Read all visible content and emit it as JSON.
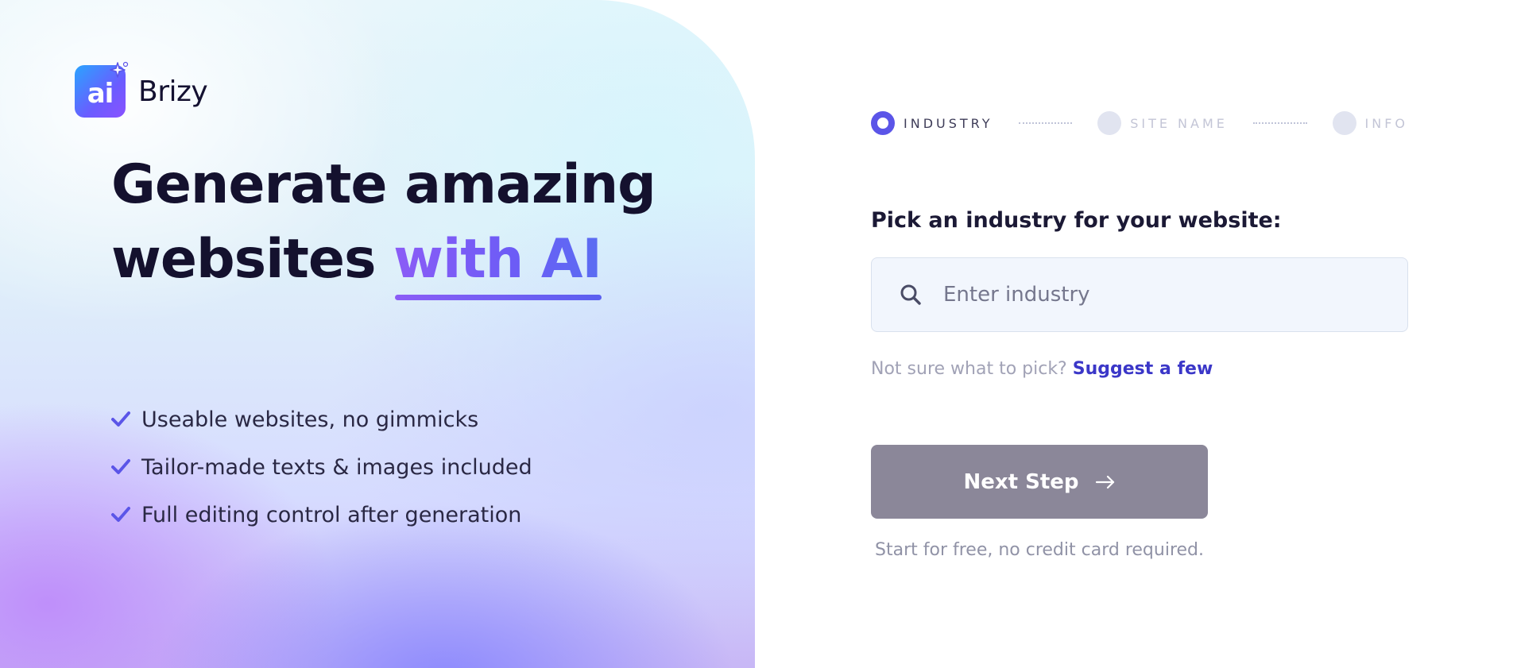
{
  "brand": {
    "logo_text": "ai",
    "name": "Brizy"
  },
  "hero": {
    "headline_line1": "Generate amazing",
    "headline_line2_prefix": "websites ",
    "headline_accent": "with AI",
    "features": [
      "Useable websites, no gimmicks",
      "Tailor-made texts & images included",
      "Full editing control after generation"
    ]
  },
  "stepper": {
    "steps": [
      {
        "label": "INDUSTRY",
        "state": "active"
      },
      {
        "label": "SITE NAME",
        "state": "upcoming"
      },
      {
        "label": "INFO",
        "state": "upcoming"
      }
    ]
  },
  "form": {
    "question": "Pick an industry for your website:",
    "search": {
      "placeholder": "Enter industry",
      "value": "",
      "icon": "search-icon"
    },
    "hint_text": "Not sure what to pick?",
    "hint_link": "Suggest a few",
    "next_button_label": "Next Step",
    "next_button_icon": "arrow-right-icon",
    "footnote": "Start for free, no credit card required."
  },
  "colors": {
    "accent": "#5b55e8",
    "link": "#3b37c8",
    "button_disabled": "#8b8799",
    "headline": "#14112e",
    "check": "#5b55e8"
  }
}
